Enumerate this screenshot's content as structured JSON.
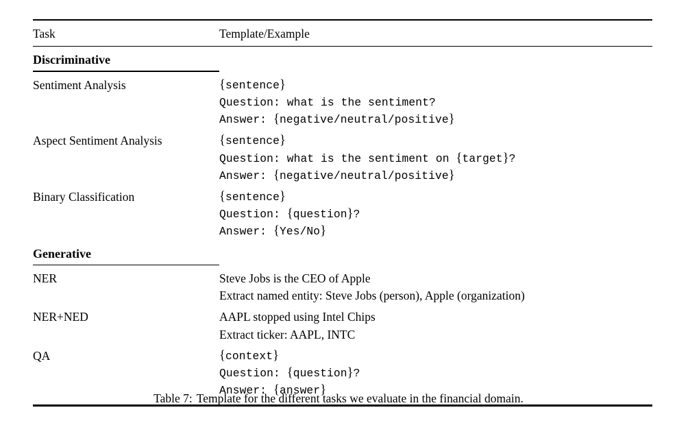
{
  "table": {
    "columns": {
      "task": "Task",
      "template": "Template/Example"
    },
    "sections": [
      {
        "heading": "Discriminative",
        "rows": [
          {
            "task": "Sentiment Analysis",
            "style": "mono",
            "lines": [
              "{sentence}",
              "Question: what is the sentiment?",
              "Answer: {negative/neutral/positive}"
            ]
          },
          {
            "task": "Aspect Sentiment Analysis",
            "style": "mono",
            "lines": [
              "{sentence}",
              "Question: what is the sentiment on {target}?",
              "Answer: {negative/neutral/positive}"
            ]
          },
          {
            "task": "Binary Classification",
            "style": "mono",
            "lines": [
              "{sentence}",
              "Question: {question}?",
              "Answer: {Yes/No}"
            ]
          }
        ]
      },
      {
        "heading": "Generative",
        "rows": [
          {
            "task": "NER",
            "style": "serif",
            "lines": [
              "Steve Jobs is the CEO of Apple",
              "Extract named entity: Steve Jobs (person), Apple (organization)"
            ]
          },
          {
            "task": "NER+NED",
            "style": "serif",
            "lines": [
              "AAPL stopped using Intel Chips",
              "Extract ticker: AAPL, INTC"
            ]
          },
          {
            "task": "QA",
            "style": "mono",
            "lines": [
              "{context}",
              "Question: {question}?",
              "Answer: {answer}"
            ]
          }
        ]
      }
    ]
  },
  "caption": {
    "label": "Table 7:",
    "text": "Template for the different tasks we evaluate in the financial domain."
  }
}
